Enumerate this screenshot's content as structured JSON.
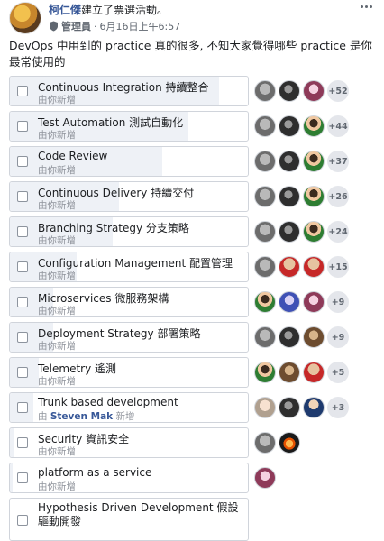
{
  "post": {
    "author": "柯仁傑",
    "action": "建立了票選活動。",
    "role": "管理員",
    "timestamp": "6月16日上午6:57",
    "separator": "·",
    "question": "DevOps 中用到的 practice 真的很多, 不知大家覺得哪些 practice 是你最常使用的"
  },
  "icons": {
    "shield": "shield-icon",
    "more": "more-options-icon"
  },
  "colors": {
    "name_link": "#385898",
    "bar_fill": "#eef1f6",
    "border": "#d0d4db"
  },
  "options": [
    {
      "label": "Continuous Integration 持續整合",
      "added_by": "由你新增",
      "fill_fraction": 0.88,
      "voters": [
        "gray",
        "dark",
        "pink"
      ],
      "more": "+52"
    },
    {
      "label": "Test Automation 測試自動化",
      "added_by": "由你新增",
      "fill_fraction": 0.75,
      "voters": [
        "gray",
        "dark",
        "green"
      ],
      "more": "+44"
    },
    {
      "label": "Code Review",
      "added_by": "由你新增",
      "fill_fraction": 0.64,
      "voters": [
        "gray",
        "dark",
        "green"
      ],
      "more": "+37"
    },
    {
      "label": "Continuous Delivery 持續交付",
      "added_by": "由你新增",
      "fill_fraction": 0.46,
      "voters": [
        "gray",
        "dark",
        "green"
      ],
      "more": "+26"
    },
    {
      "label": "Branching Strategy 分支策略",
      "added_by": "由你新增",
      "fill_fraction": 0.43,
      "voters": [
        "gray",
        "dark",
        "green"
      ],
      "more": "+24"
    },
    {
      "label": "Configuration Management 配置管理",
      "added_by": "由你新增",
      "fill_fraction": 0.28,
      "voters": [
        "gray",
        "red",
        "red"
      ],
      "more": "+15"
    },
    {
      "label": "Microservices 微服務架構",
      "added_by": "由你新增",
      "fill_fraction": 0.18,
      "voters": [
        "green",
        "blue",
        "pink"
      ],
      "more": "+9"
    },
    {
      "label": "Deployment Strategy 部署策略",
      "added_by": "由你新增",
      "fill_fraction": 0.18,
      "voters": [
        "gray",
        "dark",
        "brown"
      ],
      "more": "+9"
    },
    {
      "label": "Telemetry 遙測",
      "added_by": "由你新增",
      "fill_fraction": 0.12,
      "voters": [
        "green",
        "brown",
        "red"
      ],
      "more": "+5"
    },
    {
      "label": "Trunk based development",
      "added_by_prefix": "由",
      "added_by_name": "Steven Mak",
      "added_by_suffix": "新增",
      "fill_fraction": 0.1,
      "voters": [
        "light",
        "dark",
        "navy"
      ],
      "more": "+3"
    },
    {
      "label": "Security 資訊安全",
      "added_by": "由你新增",
      "fill_fraction": 0.02,
      "voters": [
        "gray",
        "fire"
      ],
      "more": ""
    },
    {
      "label": "platform as a service",
      "added_by": "由你新增",
      "fill_fraction": 0.01,
      "voters": [
        "pink"
      ],
      "more": ""
    },
    {
      "label": "Hypothesis Driven Development 假設驅動開發",
      "added_by": "",
      "fill_fraction": 0.0,
      "voters": [],
      "more": ""
    }
  ]
}
